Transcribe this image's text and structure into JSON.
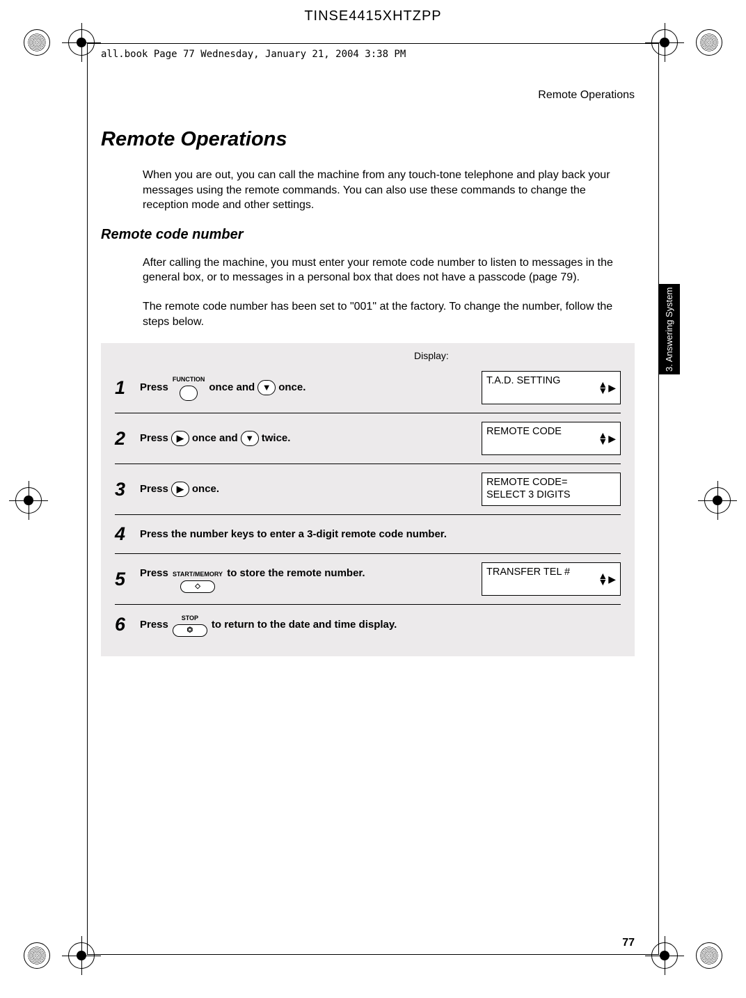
{
  "doc_header": "TINSE4415XHTZPP",
  "book_meta": "all.book  Page 77  Wednesday, January 21, 2004  3:38 PM",
  "running_head": "Remote Operations",
  "side_tab": "3. Answering System",
  "h1": "Remote Operations",
  "intro": "When you are out, you can call the machine from any touch-tone telephone and play back your messages using the remote commands. You can also use these commands to change the reception mode and other settings.",
  "h2": "Remote code number",
  "para1": "After calling the machine, you must enter your remote code number to listen to messages in the general box, or to messages in a personal box that does not have a passcode (page 79).",
  "para2": "The remote code number has been set to \"001\" at the factory. To change the number, follow the steps below.",
  "display_label": "Display:",
  "steps": [
    {
      "num": "1",
      "pre": "Press",
      "key1_label": "FUNCTION",
      "mid1": " once and ",
      "mid2": " once.",
      "display": "T.A.D. SETTING",
      "show_nav": true
    },
    {
      "num": "2",
      "pre": "Press ",
      "mid1": " once and ",
      "mid2": " twice.",
      "display": "REMOTE CODE",
      "show_nav": true
    },
    {
      "num": "3",
      "pre": "Press ",
      "mid1": " once.",
      "display_l1": "REMOTE CODE=",
      "display_l2": "SELECT 3 DIGITS"
    },
    {
      "num": "4",
      "text": "Press the number keys to enter a 3-digit remote code number."
    },
    {
      "num": "5",
      "pre": "Press ",
      "key1_label": "START/MEMORY",
      "mid1": " to store the remote number.",
      "display": "TRANSFER TEL #",
      "show_nav": true
    },
    {
      "num": "6",
      "pre": "Press ",
      "key1_label": "STOP",
      "mid1": " to return to the date and time display."
    }
  ],
  "page_num": "77",
  "icons": {
    "down_triangle": "▼",
    "right_triangle": "▶",
    "diamond": "◇",
    "hex": "⏣"
  }
}
